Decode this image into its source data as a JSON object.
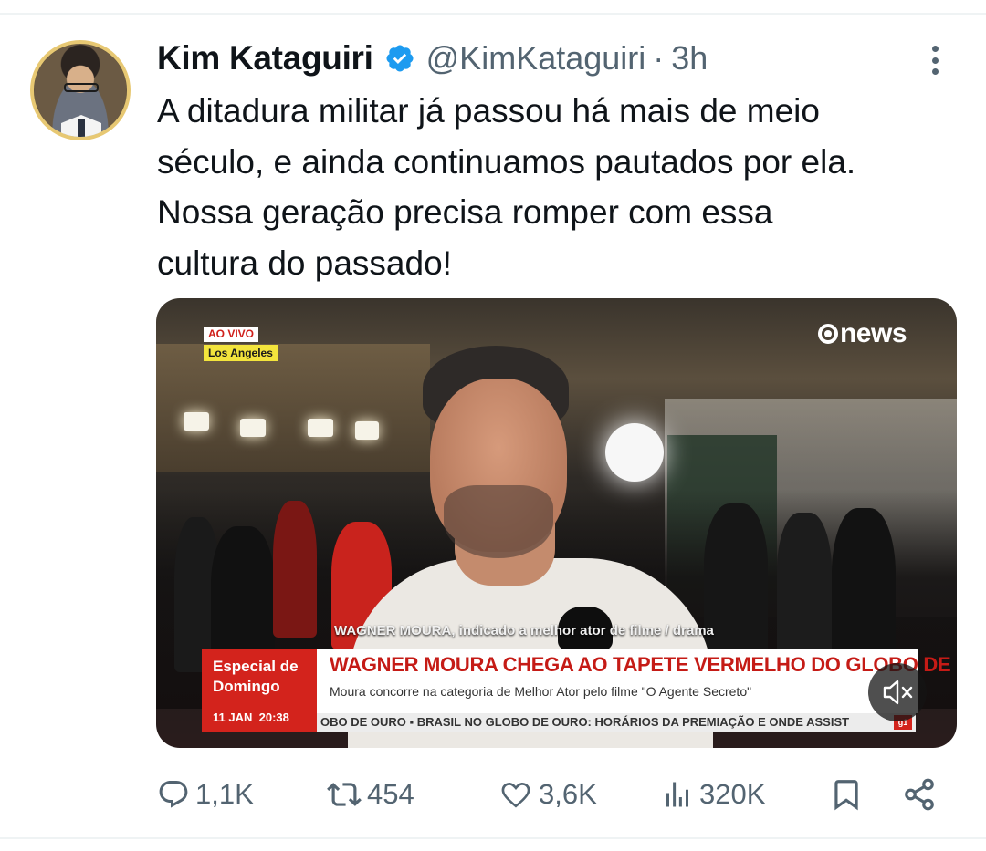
{
  "tweet": {
    "author": {
      "display_name": "Kim Kataguiri",
      "verified": true,
      "handle": "@KimKataguiri",
      "separator": "·",
      "time": "3h"
    },
    "text_lines": [
      "A ditadura militar já passou há mais de meio",
      "século, e ainda continuamos pautados por ela.",
      "Nossa geração precisa romper com essa",
      "cultura do passado!"
    ]
  },
  "video": {
    "live_tag": "AO VIVO",
    "location_tag": "Los Angeles",
    "channel_logo": "news",
    "caption_name": "WAGNER MOURA, indicado a melhor ator de filme / drama",
    "show_title": "Especial de Domingo",
    "date": "11 JAN",
    "clock": "20:38",
    "headline": "WAGNER MOURA CHEGA AO TAPETE VERMELHO DO GLOBO DE OURO",
    "subheadline": "Moura concorre na categoria de Melhor Ator pelo filme \"O Agente Secreto\"",
    "ticker": "OBO DE OURO  ▪  BRASIL NO GLOBO DE OURO: HORÁRIOS DA PREMIAÇÃO E ONDE ASSIST",
    "ticker_badge": "g1",
    "muted": true
  },
  "actions": {
    "replies": "1,1K",
    "reposts": "454",
    "likes": "3,6K",
    "views": "320K"
  },
  "icons": [
    "verified-badge-icon",
    "more-options-icon",
    "reply-icon",
    "repost-icon",
    "like-icon",
    "views-icon",
    "bookmark-icon",
    "share-icon",
    "mute-icon"
  ],
  "colors": {
    "verified_blue": "#1d9bf0",
    "secondary_text": "#536471",
    "primary_text": "#0f1419",
    "news_red": "#d3231c"
  }
}
